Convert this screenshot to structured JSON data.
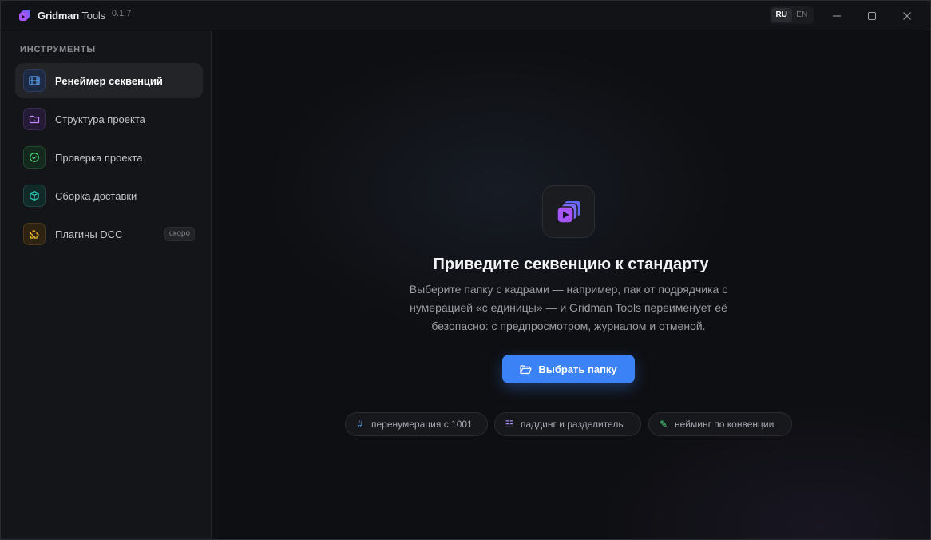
{
  "titlebar": {
    "app_name_bold": "Gridman",
    "app_name_thin": "Tools",
    "version": "0.1.7",
    "lang_active": "RU",
    "lang_inactive": "EN"
  },
  "sidebar": {
    "section_title": "ИНСТРУМЕНТЫ",
    "items": [
      {
        "label": "Ренеймер секвенций",
        "icon": "film-icon",
        "color": "#3b82f6",
        "active": true
      },
      {
        "label": "Структура проекта",
        "icon": "folder-icon",
        "color": "#a855f7",
        "active": false
      },
      {
        "label": "Проверка проекта",
        "icon": "check-circle-icon",
        "color": "#22c55e",
        "active": false
      },
      {
        "label": "Сборка доставки",
        "icon": "box-icon",
        "color": "#14b8a6",
        "active": false
      },
      {
        "label": "Плагины DCC",
        "icon": "puzzle-icon",
        "color": "#f59e0b",
        "active": false,
        "badge": "скоро"
      }
    ]
  },
  "main": {
    "title": "Приведите секвенцию к стандарту",
    "description": "Выберите папку с кадрами — например, пак от подрядчика с нумерацией «с единицы» — и Gridman Tools переименует её безопасно: с предпросмотром, журналом и отменой.",
    "button_label": "Выбрать папку",
    "chips": [
      {
        "label": "перенумерация с 1001",
        "icon": "#"
      },
      {
        "label": "паддинг и разделитель",
        "icon": "☷"
      },
      {
        "label": "нейминг по конвенции",
        "icon": "✎"
      }
    ]
  },
  "colors": {
    "accent": "#3b82f6",
    "brand": "#7c3aed"
  }
}
